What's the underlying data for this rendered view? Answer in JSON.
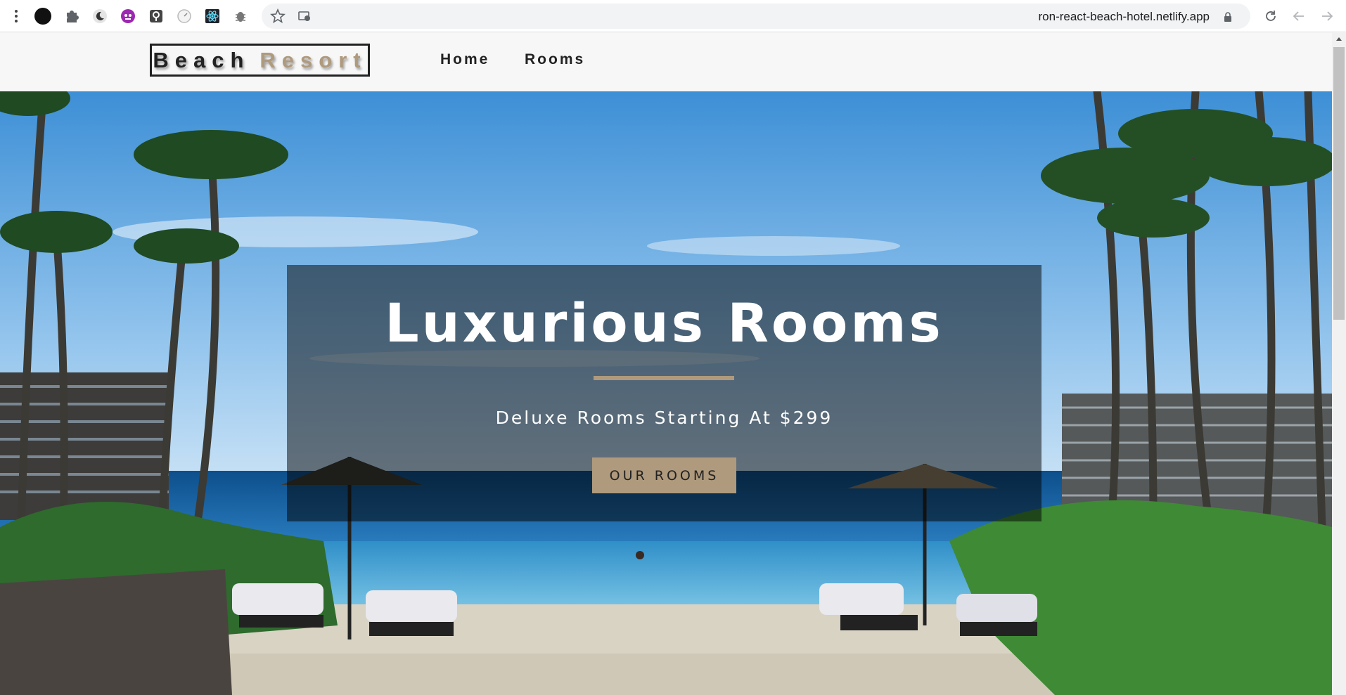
{
  "browser": {
    "url": "ron-react-beach-hotel.netlify.app",
    "extensions": [
      "black-circle-icon",
      "puzzle-icon",
      "moon-icon",
      "octocat-icon",
      "lighthouse-icon",
      "timer-icon",
      "react-devtools-icon",
      "bug-icon"
    ],
    "icons": [
      "menu-dots-icon",
      "star-icon",
      "reader-mode-icon",
      "lock-icon",
      "reload-icon",
      "back-icon",
      "forward-icon"
    ]
  },
  "navbar": {
    "logo_word1": "Beach",
    "logo_word2": "Resort",
    "links": [
      "Home",
      "Rooms"
    ]
  },
  "hero": {
    "title": "Luxurious Rooms",
    "subtitle": "Deluxe Rooms Starting At $299",
    "button_label": "OUR ROOMS"
  },
  "colors": {
    "accent": "#af9a7d",
    "text_dark": "#222222",
    "navbar_bg": "#f7f7f7"
  }
}
